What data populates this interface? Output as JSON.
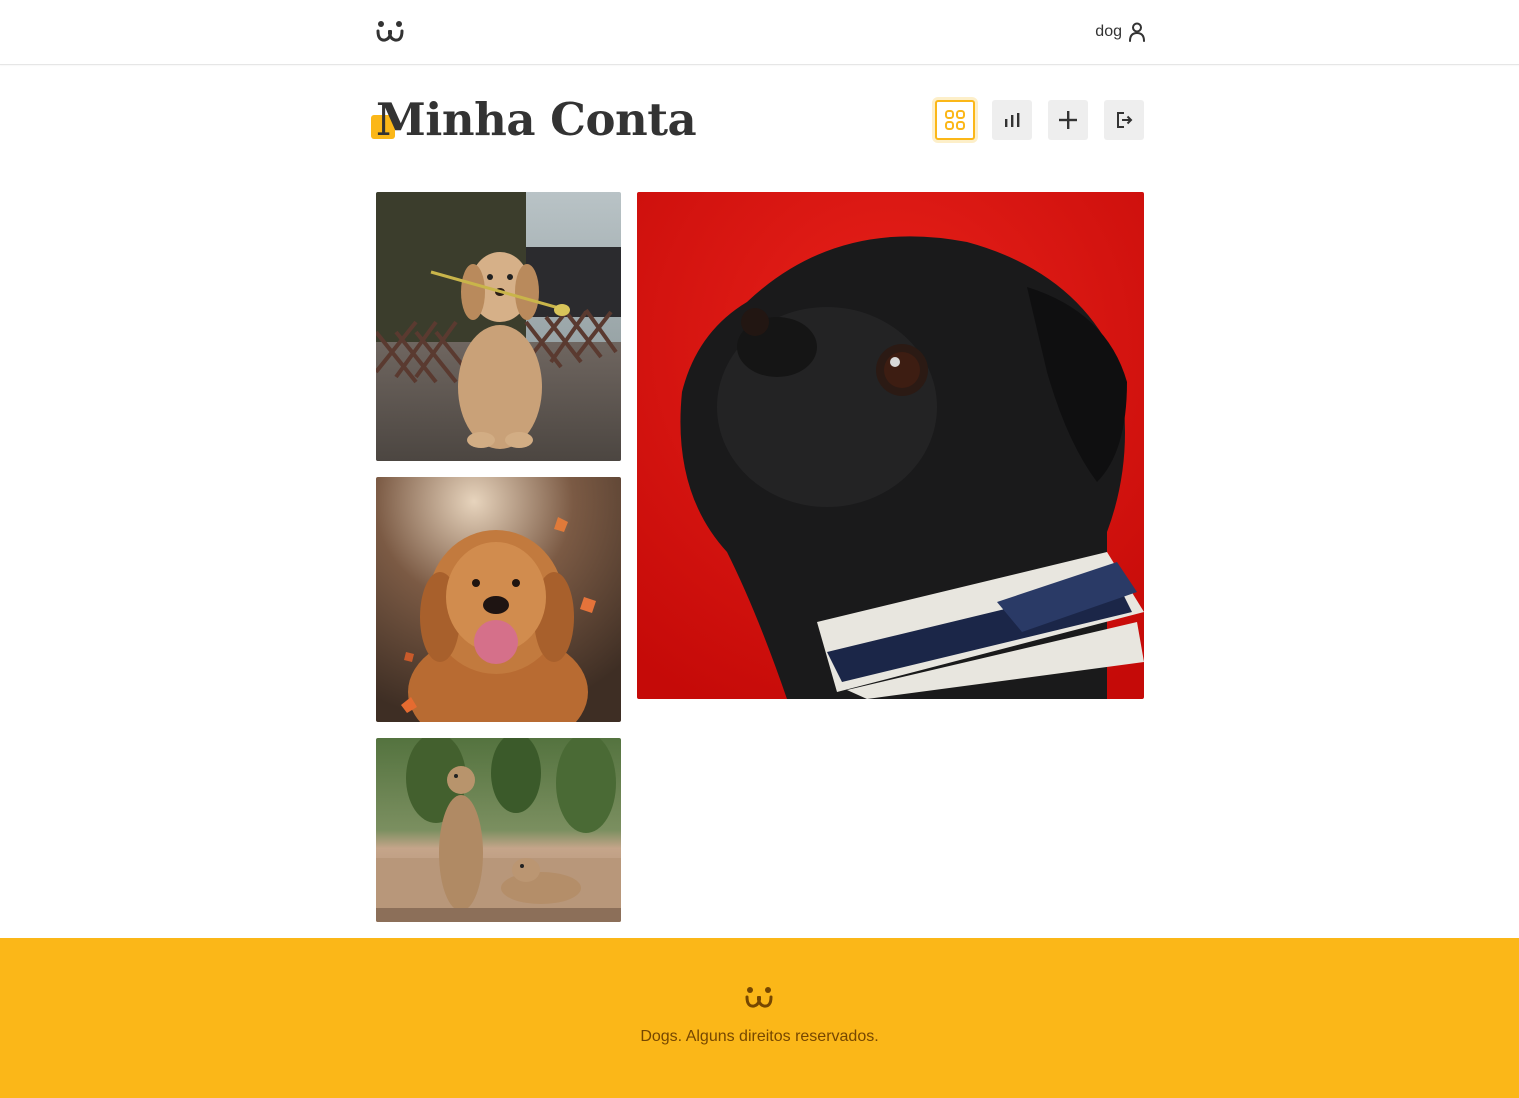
{
  "app": {
    "logo_icon": "dog-face-logo-icon",
    "accent_color": "#fbb718",
    "text_color": "#333333"
  },
  "header": {
    "username": "dog",
    "user_icon": "user-icon"
  },
  "page": {
    "title": "Minha Conta"
  },
  "account_nav": [
    {
      "name": "feed",
      "icon": "grid-icon",
      "active": true
    },
    {
      "name": "statistics",
      "icon": "bar-chart-icon",
      "active": false
    },
    {
      "name": "post-photo",
      "icon": "plus-icon",
      "active": false
    },
    {
      "name": "logout",
      "icon": "logout-icon",
      "active": false
    }
  ],
  "feed": {
    "photos": [
      {
        "subject": "golden-retriever-puppy-with-flower"
      },
      {
        "subject": "golden-retriever-autumn-leaves"
      },
      {
        "subject": "prairie-dogs"
      },
      {
        "subject": "black-pug-red-background"
      }
    ]
  },
  "footer": {
    "text": "Dogs. Alguns direitos reservados.",
    "background_color": "#fbb718",
    "text_color": "#764701"
  }
}
